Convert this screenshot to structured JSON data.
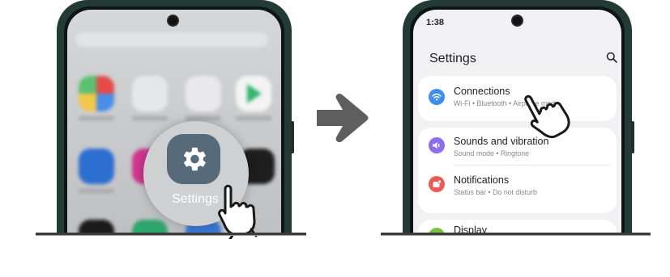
{
  "left_phone": {
    "settings_app_label": "Settings"
  },
  "right_phone": {
    "status_time": "1:38",
    "header_title": "Settings",
    "items": [
      {
        "title": "Connections",
        "subtitle": "Wi-Fi  •  Bluetooth  •  Airplane mode",
        "icon": "wifi-icon",
        "color": "#3d8ef0"
      },
      {
        "title": "Sounds and vibration",
        "subtitle": "Sound mode  •  Ringtone",
        "icon": "volume-icon",
        "color": "#8e6cf0"
      },
      {
        "title": "Notifications",
        "subtitle": "Status bar  •  Do not disturb",
        "icon": "notification-icon",
        "color": "#ec5a55"
      },
      {
        "title": "Display",
        "subtitle": "",
        "icon": "display-icon",
        "color": "#7bc043"
      }
    ]
  },
  "colors": {
    "phone_frame": "#233b34",
    "arrow": "#5e5e5e",
    "settings_icon": "#566a79"
  }
}
